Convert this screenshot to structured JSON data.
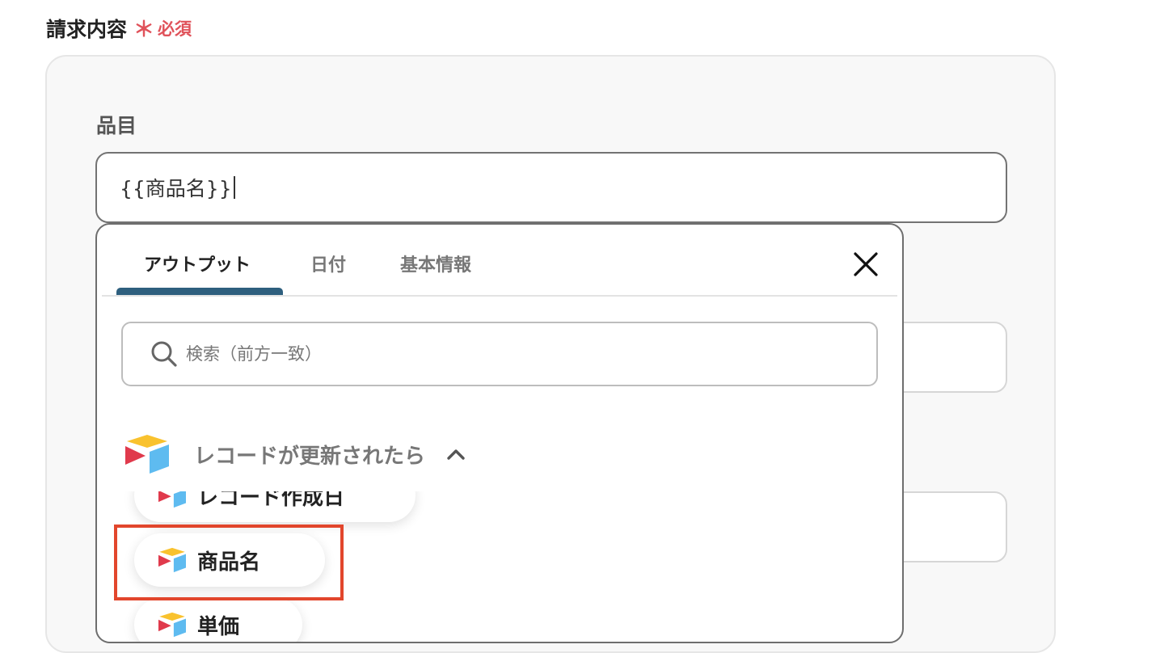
{
  "section": {
    "title": "請求内容",
    "required_mark": "＊",
    "required_text": "必須"
  },
  "item_field": {
    "label": "品目",
    "value": "{{商品名}}"
  },
  "popup": {
    "tabs": [
      {
        "label": "アウトプット",
        "active": true
      },
      {
        "label": "日付",
        "active": false
      },
      {
        "label": "基本情報",
        "active": false
      }
    ],
    "search_placeholder": "検索（前方一致）",
    "group": {
      "title": "レコードが更新されたら",
      "icon": "airtable-logo",
      "expanded": true
    },
    "items": [
      {
        "label": "レコード作成日"
      },
      {
        "label": "商品名",
        "highlighted": true
      },
      {
        "label": "単価"
      }
    ]
  },
  "colors": {
    "required": "#e0525a",
    "tab_indicator": "#2e5f7e",
    "highlight": "#e2462c",
    "panel_bg": "#f8f8f8"
  }
}
